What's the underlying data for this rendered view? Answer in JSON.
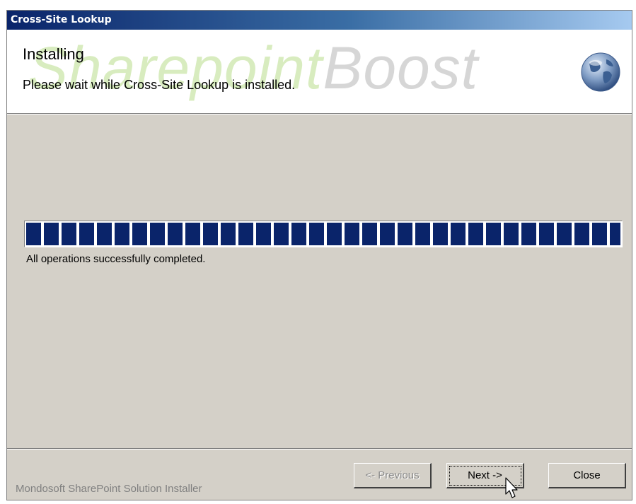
{
  "window": {
    "title": "Cross-Site Lookup"
  },
  "header": {
    "watermark_part1": "Sharepoint",
    "watermark_part2": "Boost",
    "title": "Installing",
    "subtitle": "Please wait while Cross-Site Lookup is installed."
  },
  "progress": {
    "percent": 100,
    "status_text": "All operations successfully completed."
  },
  "footer": {
    "brand": "Mondosoft SharePoint Solution Installer",
    "buttons": {
      "previous": "<- Previous",
      "next": "Next ->",
      "close": "Close"
    }
  },
  "colors": {
    "titlebar_start": "#0a246a",
    "titlebar_end": "#a6caf0",
    "progress_block": "#0a246a",
    "dialog_face": "#d4d0c8"
  }
}
